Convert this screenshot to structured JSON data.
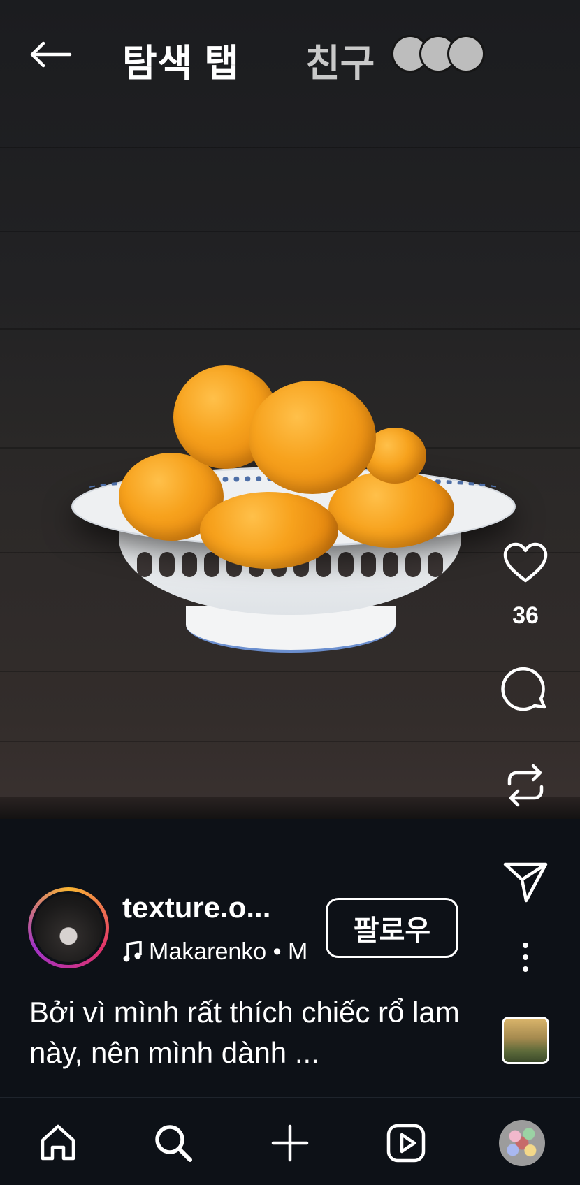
{
  "header": {
    "title": "탐색 탭",
    "friends_label": "친구"
  },
  "rail": {
    "like_count": "36"
  },
  "post": {
    "username": "texture.o...",
    "music": "Makarenko • M",
    "follow_label": "팔로우",
    "caption": "Bởi vì mình rất thích chiếc rổ lam này, nên mình dành ..."
  },
  "icons": {
    "back": "back-arrow-icon",
    "like": "heart-icon",
    "comment": "comment-icon",
    "repost": "repost-icon",
    "share": "send-icon",
    "more": "more-vertical-icon",
    "music": "music-note-icon",
    "home": "home-icon",
    "search": "search-icon",
    "create": "plus-icon",
    "reels": "reels-icon"
  },
  "colors": {
    "background": "#0d1117",
    "story_ring_start": "#f8b532",
    "story_ring_end": "#a032c7",
    "orange": "#f7a21d"
  }
}
